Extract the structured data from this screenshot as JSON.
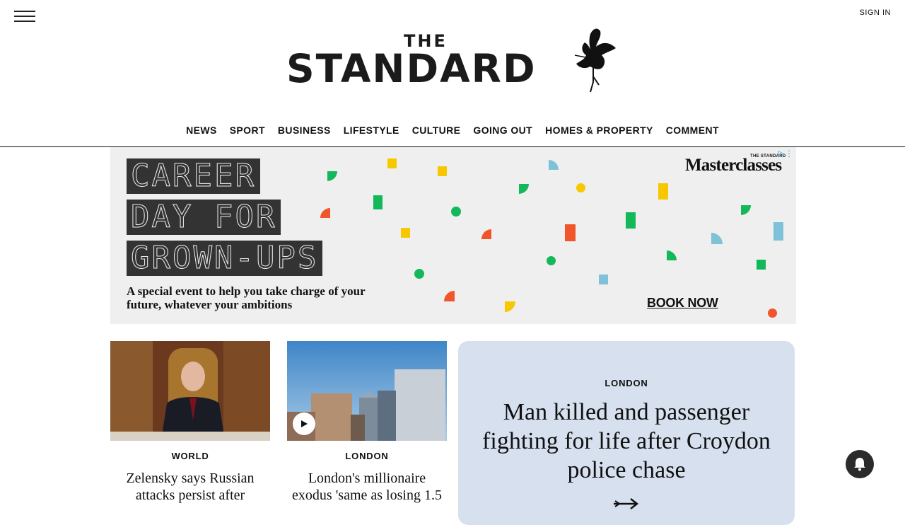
{
  "header": {
    "signin_label": "SIGN IN",
    "logo_the": "THE",
    "logo_main": "STANDARD"
  },
  "nav": {
    "items": [
      "NEWS",
      "SPORT",
      "BUSINESS",
      "LIFESTYLE",
      "CULTURE",
      "GOING OUT",
      "HOMES & PROPERTY",
      "COMMENT"
    ]
  },
  "ad": {
    "lines": [
      "CAREER",
      "DAY FOR",
      "GROWN-UPS"
    ],
    "subtitle": "A special event to help you take charge of your future, whatever your ambitions",
    "cta": "BOOK NOW",
    "brand": "Masterclasses",
    "brand_small": "THE STANDARD",
    "colors": {
      "background": "#efefef",
      "green": "#13b85a",
      "yellow": "#f7c800",
      "orange": "#f0562a",
      "blue": "#7fc1d6",
      "dark": "#333333"
    }
  },
  "cards": [
    {
      "category": "WORLD",
      "headline": "Zelensky says Russian attacks persist after"
    },
    {
      "category": "LONDON",
      "headline": "London's millionaire exodus 'same as losing 1.5"
    }
  ],
  "feature": {
    "category": "LONDON",
    "headline": "Man killed and passenger fighting for life after Croydon police chase",
    "background": "#d6e0ee"
  },
  "icons": {
    "menu": "hamburger-icon",
    "play": "play-icon",
    "bell": "bell-icon",
    "ad_choices": "ad-choices-icon",
    "arrow": "arrow-right-icon"
  }
}
